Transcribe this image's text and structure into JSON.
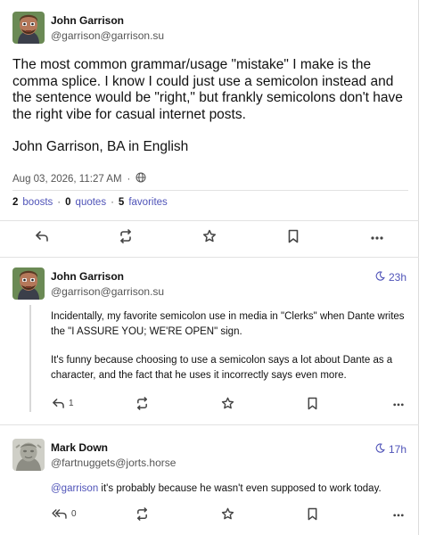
{
  "post": {
    "author_name": "John Garrison",
    "author_handle": "@garrison@garrison.su",
    "body_paragraphs": [
      "The most common grammar/usage \"mistake\" I make is the comma splice. I know I could just use a semicolon instead and the sentence would be \"right,\" but frankly semicolons don't have the right vibe for casual internet posts.",
      "John Garrison, BA in English"
    ],
    "timestamp": "Aug 03, 2026, 11:27 AM",
    "separator": "·",
    "boosts_count": "2",
    "boosts_label": "boosts",
    "quotes_count": "0",
    "quotes_label": "quotes",
    "favorites_count": "5",
    "favorites_label": "favorites"
  },
  "replies": [
    {
      "author_name": "John Garrison",
      "author_handle": "@garrison@garrison.su",
      "relative_time": "23h",
      "paragraphs": [
        "Incidentally, my favorite semicolon use in media in \"Clerks\" when Dante writes the \"I ASSURE YOU; WE'RE OPEN\" sign.",
        "It's funny because choosing to use a semicolon says a lot about Dante as a character, and the fact that he uses it incorrectly says even more."
      ],
      "reply_count": "1"
    },
    {
      "author_name": "Mark Down",
      "author_handle": "@fartnuggets@jorts.horse",
      "relative_time": "17h",
      "mention": "@garrison",
      "text": " it's probably because he wasn't even supposed to work today.",
      "reply_count": "0"
    }
  ],
  "icons": {
    "reply": "reply-icon",
    "reply_all": "reply-all-icon",
    "boost": "boost-icon",
    "favorite": "star-icon",
    "bookmark": "bookmark-icon",
    "more": "more-icon",
    "visibility": "globe-icon",
    "time": "moon-icon"
  },
  "colors": {
    "accent": "#4f53b8",
    "text": "#111111",
    "muted": "#555555"
  }
}
